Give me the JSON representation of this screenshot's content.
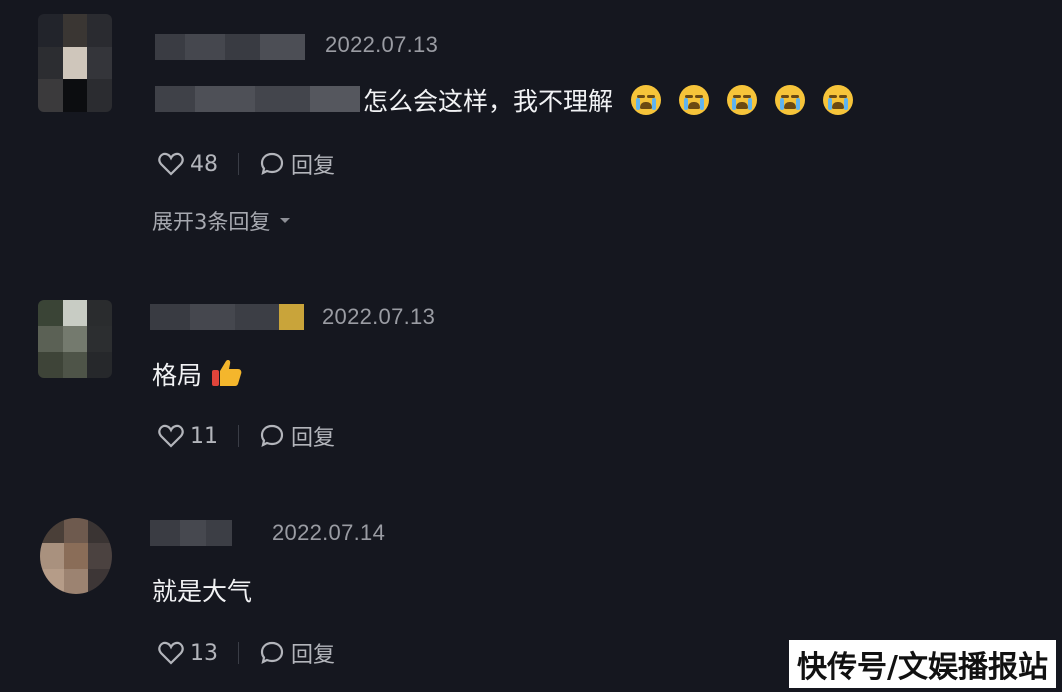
{
  "comments": [
    {
      "date": "2022.07.13",
      "text": "怎么会这样，我不理解",
      "emoji_names": [
        "loudly-crying-face",
        "loudly-crying-face",
        "loudly-crying-face",
        "loudly-crying-face",
        "loudly-crying-face"
      ],
      "likes": "48",
      "reply_label": "回复",
      "expand_label": "展开3条回复"
    },
    {
      "date": "2022.07.13",
      "text": "格局",
      "emoji_names": [
        "thumbs-up"
      ],
      "likes": "11",
      "reply_label": "回复"
    },
    {
      "date": "2022.07.14",
      "text": "就是大气",
      "likes": "13",
      "reply_label": "回复"
    }
  ],
  "watermark": "快传号/文娱播报站",
  "colors": {
    "background": "#15171f",
    "text": "#f1f2f4",
    "muted": "#9a9ca3",
    "emoji": "#f6c43a"
  }
}
